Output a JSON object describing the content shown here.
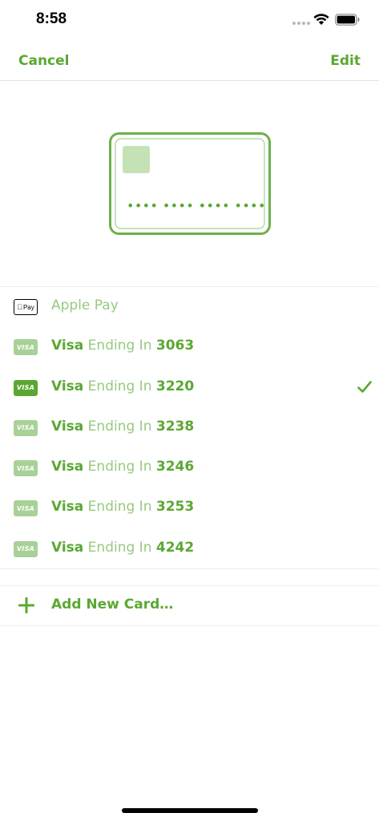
{
  "status_bar": {
    "time": "8:58"
  },
  "nav": {
    "cancel_label": "Cancel",
    "edit_label": "Edit"
  },
  "card_illustration": {
    "masked_number": "•••• •••• •••• ••••"
  },
  "payment_methods": [
    {
      "icon": "apple-pay-icon",
      "badge_text": "Pay",
      "brand": "",
      "middle": "Apple Pay",
      "last4": "",
      "selected": false
    },
    {
      "icon": "visa-icon",
      "badge_text": "VISA",
      "brand": "Visa",
      "middle": " Ending In ",
      "last4": "3063",
      "selected": false
    },
    {
      "icon": "visa-icon",
      "badge_text": "VISA",
      "brand": "Visa",
      "middle": " Ending In ",
      "last4": "3220",
      "selected": true
    },
    {
      "icon": "visa-icon",
      "badge_text": "VISA",
      "brand": "Visa",
      "middle": " Ending In ",
      "last4": "3238",
      "selected": false
    },
    {
      "icon": "visa-icon",
      "badge_text": "VISA",
      "brand": "Visa",
      "middle": " Ending In ",
      "last4": "3246",
      "selected": false
    },
    {
      "icon": "visa-icon",
      "badge_text": "VISA",
      "brand": "Visa",
      "middle": " Ending In ",
      "last4": "3253",
      "selected": false
    },
    {
      "icon": "visa-icon",
      "badge_text": "VISA",
      "brand": "Visa",
      "middle": " Ending In ",
      "last4": "4242",
      "selected": false
    }
  ],
  "add_card": {
    "label": "Add New Card…",
    "icon": "plus-icon"
  },
  "colors": {
    "accent": "#5aa832",
    "accent_light": "#97c980",
    "badge_light": "#a8d097"
  }
}
